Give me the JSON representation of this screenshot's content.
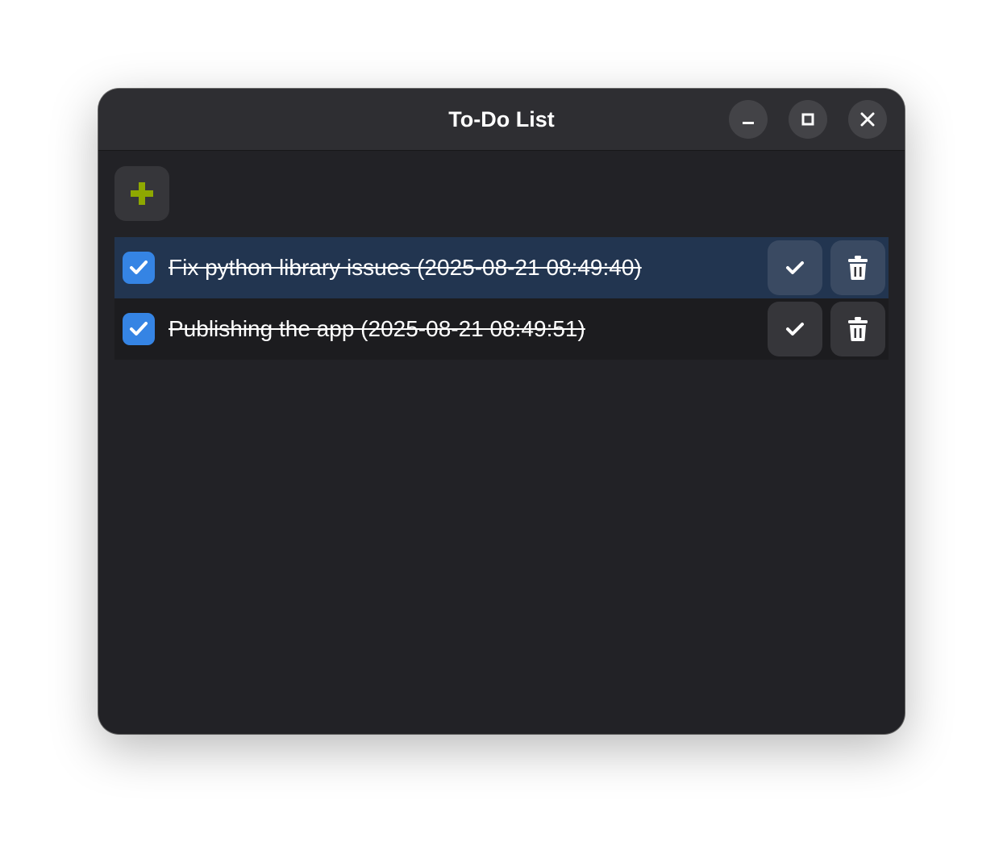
{
  "window": {
    "title": "To-Do List"
  },
  "toolbar": {
    "add_icon": "plus-icon",
    "add_icon_color": "#8ea800"
  },
  "titlebar_controls": [
    "minimize-icon",
    "maximize-icon",
    "close-icon"
  ],
  "tasks": [
    {
      "text": "Fix python library issues (2025-08-21 08:49:40)",
      "checked": true,
      "selected": true
    },
    {
      "text": "Publishing the app (2025-08-21 08:49:51)",
      "checked": true,
      "selected": false
    }
  ],
  "colors": {
    "accent": "#3584e4",
    "selected_row": "#223550"
  }
}
